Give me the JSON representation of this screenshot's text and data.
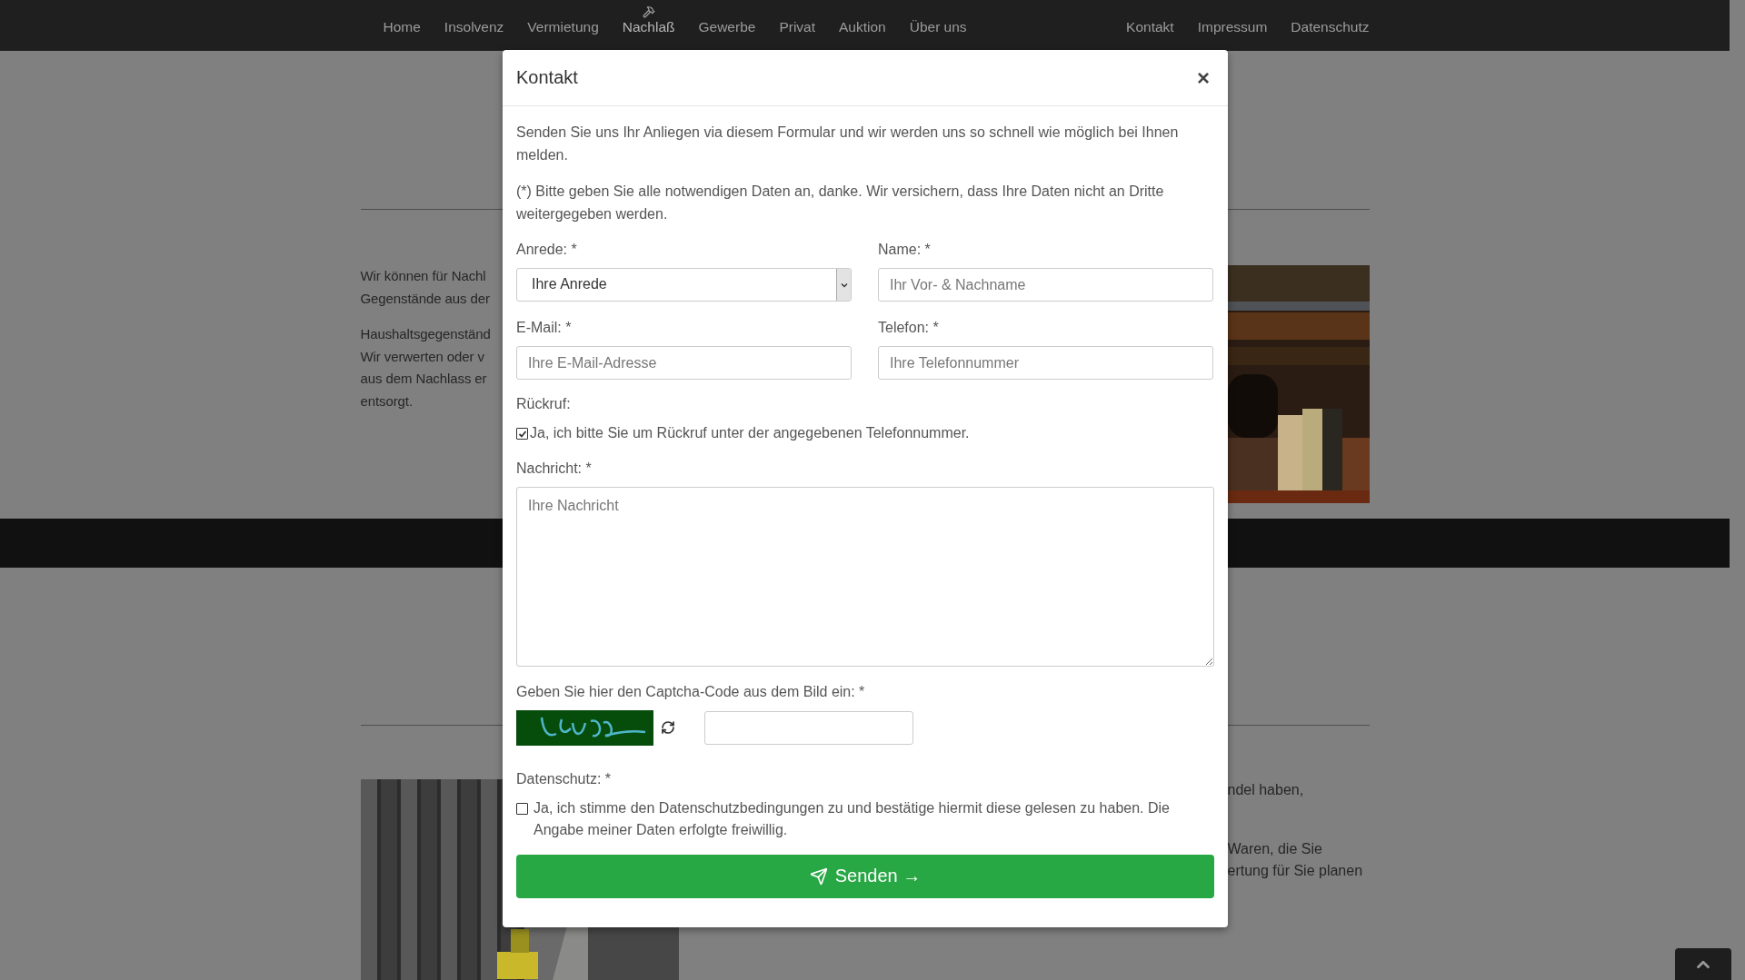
{
  "navbar": {
    "left_items": [
      {
        "label": "Home",
        "current": false
      },
      {
        "label": "Insolvenz",
        "current": false
      },
      {
        "label": "Vermietung",
        "current": false
      },
      {
        "label": "Nachlaß",
        "current": true
      },
      {
        "label": "Gewerbe",
        "current": false
      },
      {
        "label": "Privat",
        "current": false
      },
      {
        "label": "Auktion",
        "current": false
      },
      {
        "label": "Über uns",
        "current": false
      }
    ],
    "right_items": [
      {
        "label": "Kontakt"
      },
      {
        "label": "Impressum"
      },
      {
        "label": "Datenschutz"
      }
    ]
  },
  "page": {
    "intro_paragraphs": [
      [
        "Wir können für Nachl",
        "Gegenstände aus der"
      ],
      [
        "Haushaltsgegenständ",
        "Wir verwerten oder v",
        "aus dem Nachlass er",
        "entsorgt."
      ]
    ],
    "lower_paragraphs": [
      [
        "ndel haben,"
      ],
      [
        "Waren, die Sie",
        "ertung für Sie planen"
      ]
    ]
  },
  "modal": {
    "title": "Kontakt",
    "close": "×",
    "intro": "Senden Sie uns Ihr Anliegen via diesem Formular und wir werden uns so schnell wie möglich bei Ihnen melden.",
    "note": "(*) Bitte geben Sie alle notwendigen Daten an, danke. Wir versichern, dass Ihre Daten nicht an Dritte weitergegeben werden.",
    "salutation": {
      "label": "Anrede: *",
      "value": "Ihre Anrede"
    },
    "name": {
      "label": "Name: *",
      "placeholder": "Ihr Vor- & Nachname"
    },
    "email": {
      "label": "E-Mail: *",
      "placeholder": "Ihre E-Mail-Adresse"
    },
    "phone": {
      "label": "Telefon: *",
      "placeholder": "Ihre Telefonnummer"
    },
    "callback": {
      "label": "Rückruf:",
      "option": "Ja, ich bitte Sie um Rückruf unter der angegebenen Telefonnummer.",
      "checked": true
    },
    "message": {
      "label": "Nachricht: *",
      "placeholder": "Ihre Nachricht"
    },
    "captcha": {
      "label": "Geben Sie hier den Captcha-Code aus dem Bild ein: *"
    },
    "privacy": {
      "label": "Datenschutz: *",
      "option": "Ja, ich stimme den Datenschutzbedingungen zu und bestätige hiermit diese gelesen zu haben. Die Angabe meiner Daten erfolgte freiwillig.",
      "checked": false
    },
    "submit": "Senden →"
  }
}
